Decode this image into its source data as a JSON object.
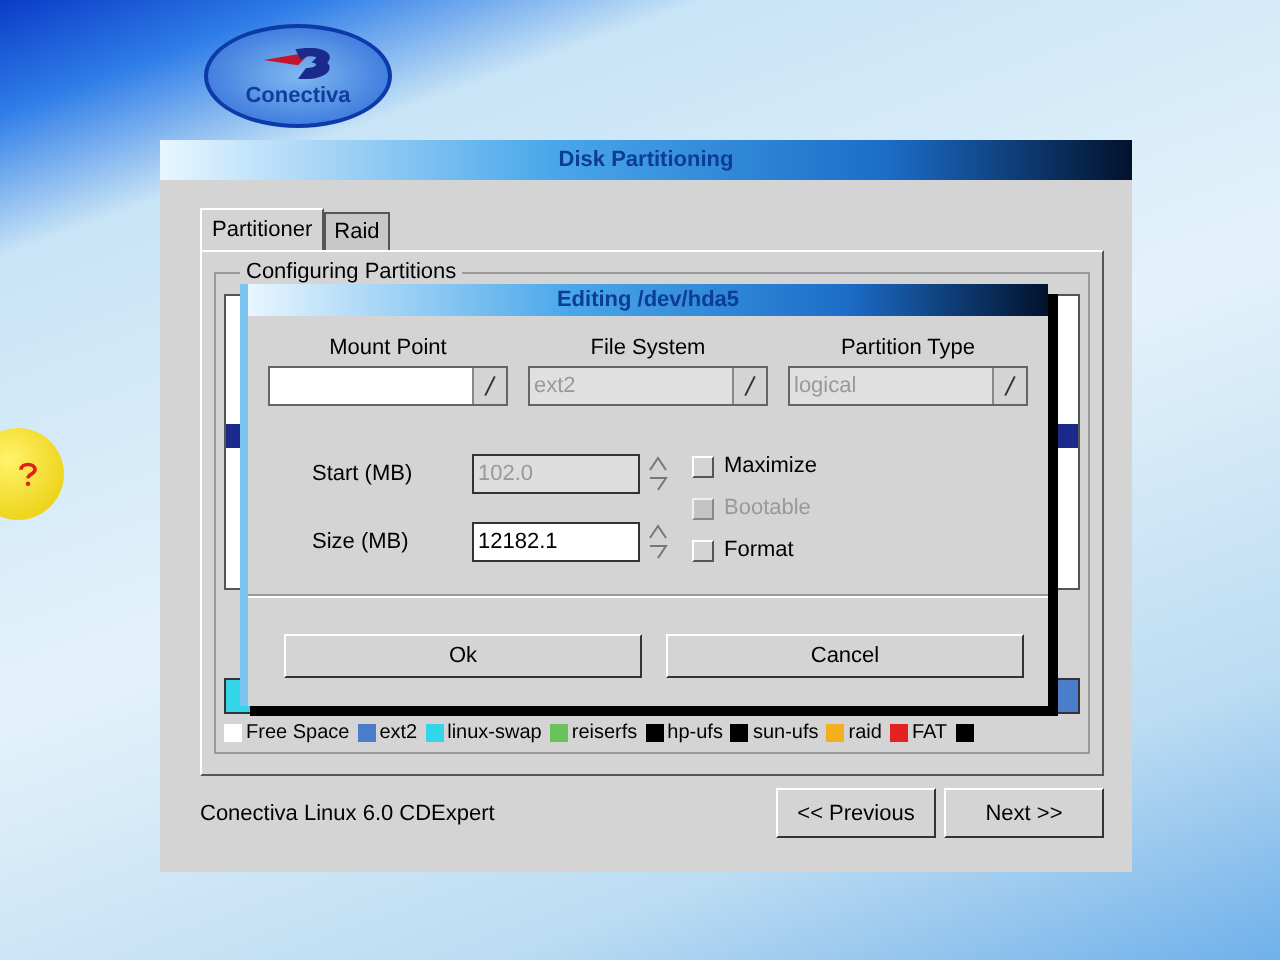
{
  "logo": {
    "text": "Conectiva"
  },
  "window": {
    "title": "Disk Partitioning"
  },
  "tabs": [
    {
      "label": "Partitioner",
      "selected": true
    },
    {
      "label": "Raid",
      "selected": false
    }
  ],
  "group": {
    "title": "Configuring Partitions"
  },
  "legend": [
    {
      "label": "Free Space",
      "color": "#ffffff"
    },
    {
      "label": "ext2",
      "color": "#4a7ecb"
    },
    {
      "label": "linux-swap",
      "color": "#33d6e8"
    },
    {
      "label": "reiserfs",
      "color": "#6cc25a"
    },
    {
      "label": "hp-ufs",
      "color": "#000000"
    },
    {
      "label": "sun-ufs",
      "color": "#000000"
    },
    {
      "label": "raid",
      "color": "#f2b01e"
    },
    {
      "label": "FAT",
      "color": "#e52222"
    },
    {
      "color": "#000000"
    }
  ],
  "dialog": {
    "title": "Editing /dev/hda5",
    "combos": [
      {
        "label": "Mount Point",
        "disabled": false
      },
      {
        "label": "File System",
        "value": "ext2",
        "disabled": true
      },
      {
        "label": "Partition Type",
        "value": "logical",
        "disabled": true
      }
    ],
    "spinners": [
      {
        "label": "Start (MB)",
        "value": "102.0",
        "disabled": true
      },
      {
        "label": "Size (MB)",
        "value": "12182.1",
        "disabled": false
      }
    ],
    "options": [
      {
        "label": "Maximize",
        "checked": false,
        "disabled": false
      },
      {
        "label": "Bootable",
        "checked": false,
        "disabled": true
      },
      {
        "label": "Format",
        "checked": false,
        "disabled": false
      }
    ],
    "buttons": [
      "Ok",
      "Cancel"
    ]
  },
  "status_text": "Conectiva Linux 6.0 CDExpert",
  "nav_buttons": [
    "<< Previous",
    "Next >>"
  ]
}
